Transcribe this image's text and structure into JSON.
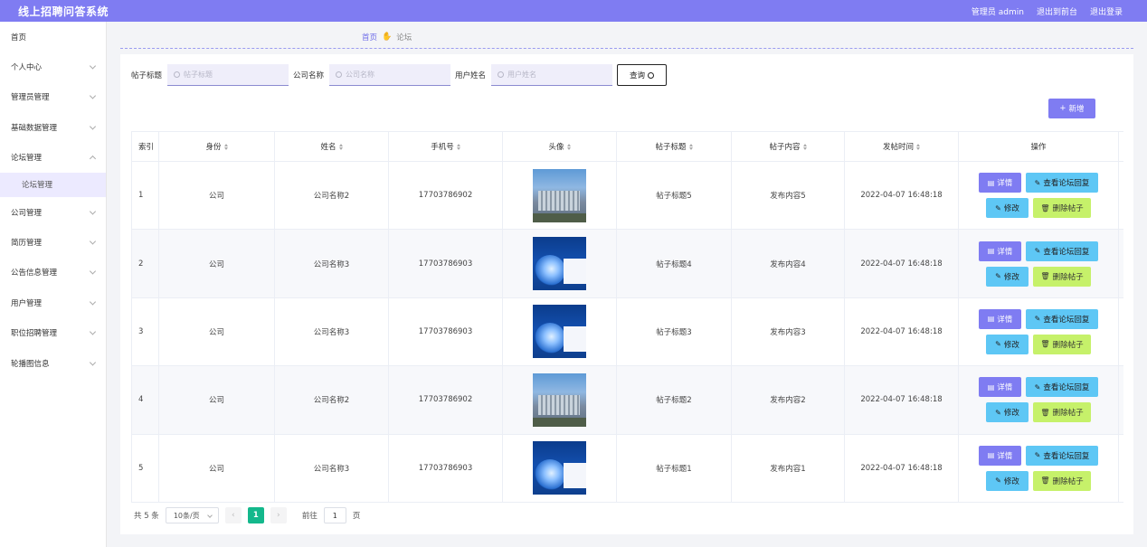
{
  "app": {
    "title": "线上招聘问答系统",
    "admin": "管理员 admin",
    "to_front": "退出到前台",
    "logout": "退出登录"
  },
  "sidebar": {
    "items": [
      {
        "label": "首页",
        "expandable": false
      },
      {
        "label": "个人中心",
        "expandable": true
      },
      {
        "label": "管理员管理",
        "expandable": true
      },
      {
        "label": "基础数据管理",
        "expandable": true
      },
      {
        "label": "论坛管理",
        "expandable": true,
        "expanded": true
      },
      {
        "label": "公司管理",
        "expandable": true
      },
      {
        "label": "简历管理",
        "expandable": true
      },
      {
        "label": "公告信息管理",
        "expandable": true
      },
      {
        "label": "用户管理",
        "expandable": true
      },
      {
        "label": "职位招聘管理",
        "expandable": true
      },
      {
        "label": "轮播图信息",
        "expandable": true
      }
    ],
    "sub_item": "论坛管理"
  },
  "breadcrumb": {
    "home": "首页",
    "current": "论坛"
  },
  "search": {
    "fields": [
      {
        "label": "帖子标题",
        "placeholder": "帖子标题"
      },
      {
        "label": "公司名称",
        "placeholder": "公司名称"
      },
      {
        "label": "用户姓名",
        "placeholder": "用户姓名"
      }
    ],
    "button": "查询"
  },
  "add_button": "新增",
  "table": {
    "headers": [
      "索引",
      "身份",
      "姓名",
      "手机号",
      "头像",
      "帖子标题",
      "帖子内容",
      "发帖时间",
      "操作"
    ],
    "rows": [
      {
        "index": "1",
        "role": "公司",
        "name": "公司名称2",
        "phone": "17703786902",
        "avatar": "building-photo",
        "title": "帖子标题5",
        "content": "发布内容5",
        "time": "2022-04-07 16:48:18"
      },
      {
        "index": "2",
        "role": "公司",
        "name": "公司名称3",
        "phone": "17703786903",
        "avatar": "company-intro-cover",
        "title": "帖子标题4",
        "content": "发布内容4",
        "time": "2022-04-07 16:48:18"
      },
      {
        "index": "3",
        "role": "公司",
        "name": "公司名称3",
        "phone": "17703786903",
        "avatar": "company-intro-cover",
        "title": "帖子标题3",
        "content": "发布内容3",
        "time": "2022-04-07 16:48:18"
      },
      {
        "index": "4",
        "role": "公司",
        "name": "公司名称2",
        "phone": "17703786902",
        "avatar": "building-photo",
        "title": "帖子标题2",
        "content": "发布内容2",
        "time": "2022-04-07 16:48:18"
      },
      {
        "index": "5",
        "role": "公司",
        "name": "公司名称3",
        "phone": "17703786903",
        "avatar": "company-intro-cover",
        "title": "帖子标题1",
        "content": "发布内容1",
        "time": "2022-04-07 16:48:18"
      }
    ],
    "actions": {
      "detail": "详情",
      "reply": "查看论坛回复",
      "edit": "修改",
      "delete": "删除帖子"
    }
  },
  "pager": {
    "total": "共 5 条",
    "page_size": "10条/页",
    "current": "1",
    "goto_label": "前往",
    "goto_value": "1",
    "page_unit": "页"
  },
  "colors": {
    "primary": "#7f7cf2",
    "info": "#5ec7f5",
    "danger_lime": "#c6f16a",
    "pager_active": "#14b88c"
  }
}
